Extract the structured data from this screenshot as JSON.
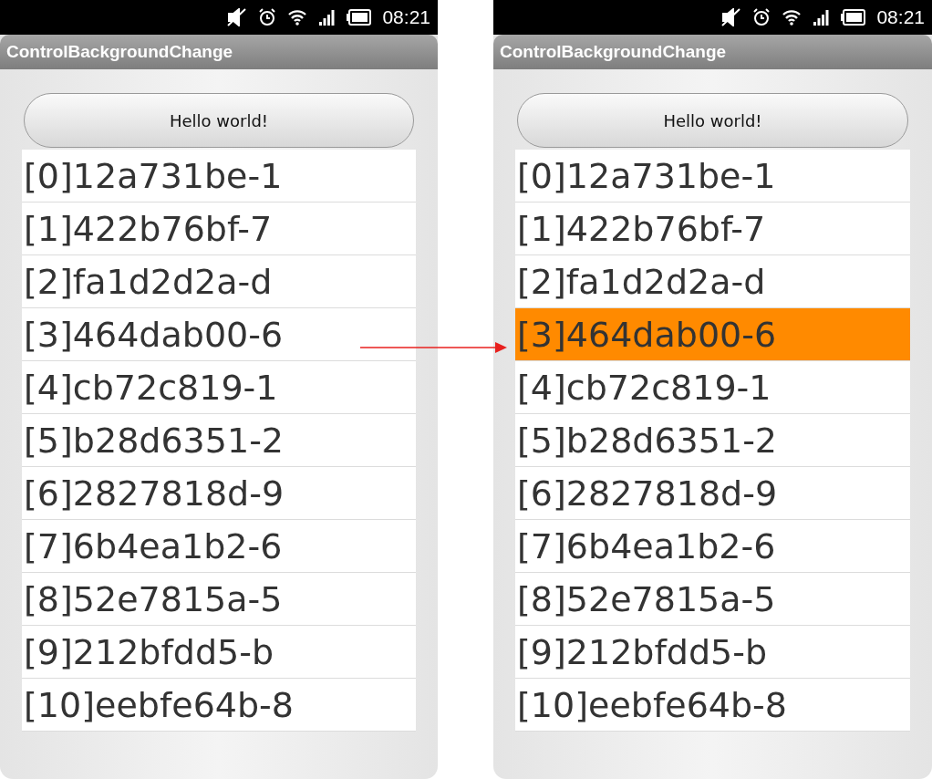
{
  "phones": [
    {
      "status": {
        "time": "08:21"
      },
      "title": "ControlBackgroundChange",
      "button": "Hello world!",
      "items": [
        {
          "text": "[0]12a731be-1",
          "selected": false
        },
        {
          "text": "[1]422b76bf-7",
          "selected": false
        },
        {
          "text": "[2]fa1d2d2a-d",
          "selected": false
        },
        {
          "text": "[3]464dab00-6",
          "selected": false
        },
        {
          "text": "[4]cb72c819-1",
          "selected": false
        },
        {
          "text": "[5]b28d6351-2",
          "selected": false
        },
        {
          "text": "[6]2827818d-9",
          "selected": false
        },
        {
          "text": "[7]6b4ea1b2-6",
          "selected": false
        },
        {
          "text": "[8]52e7815a-5",
          "selected": false
        },
        {
          "text": "[9]212bfdd5-b",
          "selected": false
        },
        {
          "text": "[10]eebfe64b-8",
          "selected": false
        }
      ]
    },
    {
      "status": {
        "time": "08:21"
      },
      "title": "ControlBackgroundChange",
      "button": "Hello world!",
      "items": [
        {
          "text": "[0]12a731be-1",
          "selected": false
        },
        {
          "text": "[1]422b76bf-7",
          "selected": false
        },
        {
          "text": "[2]fa1d2d2a-d",
          "selected": false
        },
        {
          "text": "[3]464dab00-6",
          "selected": true
        },
        {
          "text": "[4]cb72c819-1",
          "selected": false
        },
        {
          "text": "[5]b28d6351-2",
          "selected": false
        },
        {
          "text": "[6]2827818d-9",
          "selected": false
        },
        {
          "text": "[7]6b4ea1b2-6",
          "selected": false
        },
        {
          "text": "[8]52e7815a-5",
          "selected": false
        },
        {
          "text": "[9]212bfdd5-b",
          "selected": false
        },
        {
          "text": "[10]eebfe64b-8",
          "selected": false
        }
      ]
    }
  ]
}
